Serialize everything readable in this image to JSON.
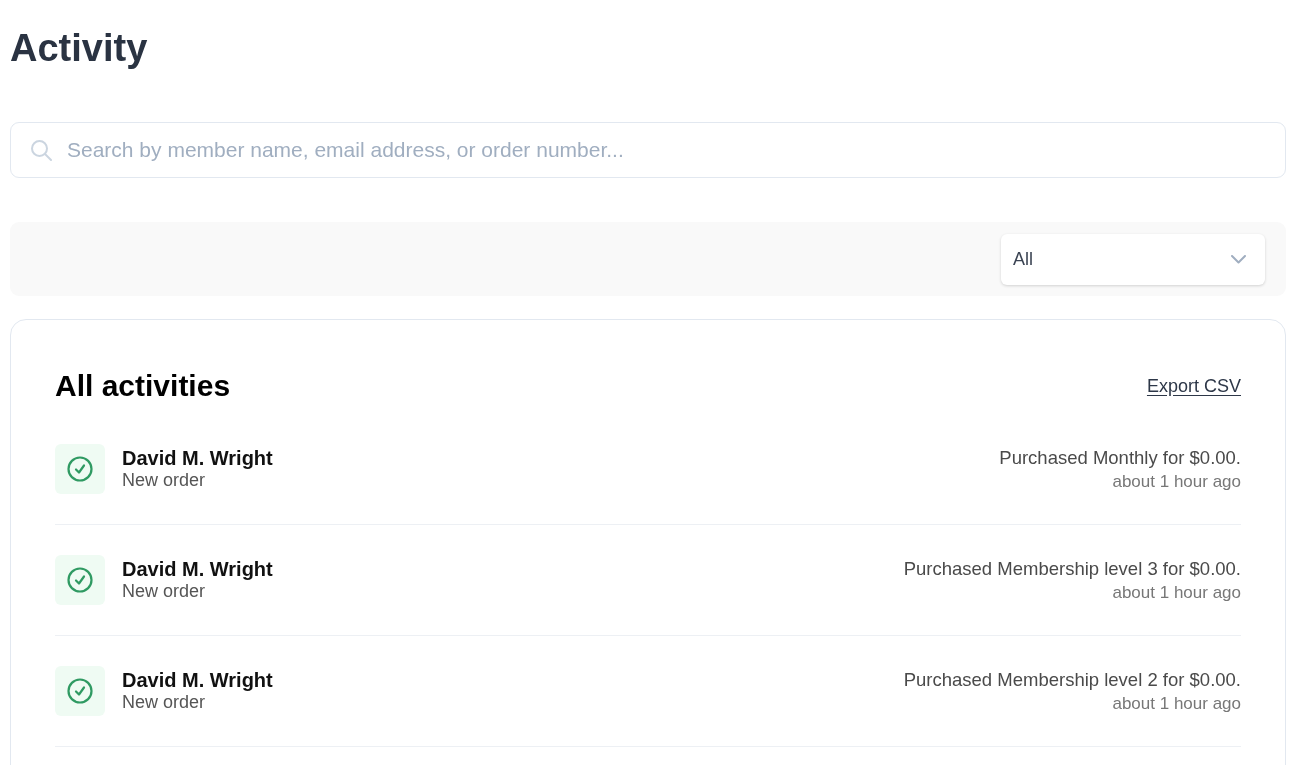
{
  "page": {
    "title": "Activity"
  },
  "search": {
    "placeholder": "Search by member name, email address, or order number..."
  },
  "filter": {
    "value": "All"
  },
  "activities": {
    "title": "All activities",
    "export_link": "Export CSV",
    "items": [
      {
        "kind": "completed",
        "name": "David M. Wright",
        "type": "New order",
        "description": "Purchased Monthly for $0.00.",
        "time": "about 1 hour ago"
      },
      {
        "kind": "completed",
        "name": "David M. Wright",
        "type": "New order",
        "description": "Purchased Membership level 3 for $0.00.",
        "time": "about 1 hour ago"
      },
      {
        "kind": "completed",
        "name": "David M. Wright",
        "type": "New order",
        "description": "Purchased Membership level 2 for $0.00.",
        "time": "about 1 hour ago"
      }
    ]
  }
}
